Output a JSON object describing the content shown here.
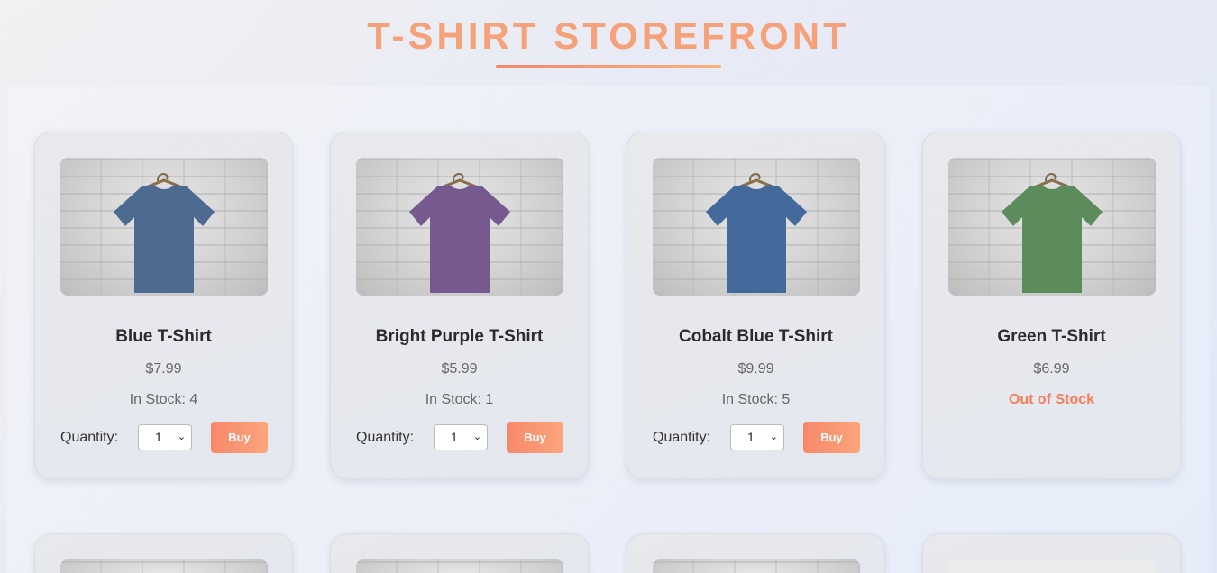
{
  "header": {
    "title": "T-SHIRT STOREFRONT"
  },
  "colors": {
    "accent": "#f5a27a",
    "accent_dark": "#f4866a",
    "out_of_stock": "#f57d5a"
  },
  "labels": {
    "quantity": "Quantity:",
    "buy": "Buy"
  },
  "products": [
    {
      "name": "Blue T-Shirt",
      "price": "$7.99",
      "stock": "In Stock: 4",
      "quantity": "1",
      "shirt_color": "#4d6b91"
    },
    {
      "name": "Bright Purple T-Shirt",
      "price": "$5.99",
      "stock": "In Stock: 1",
      "quantity": "1",
      "shirt_color": "#765a8f"
    },
    {
      "name": "Cobalt Blue T-Shirt",
      "price": "$9.99",
      "stock": "In Stock: 5",
      "quantity": "1",
      "shirt_color": "#436a9b"
    },
    {
      "name": "Green T-Shirt",
      "price": "$6.99",
      "stock": "Out of Stock",
      "shirt_color": "#5d8c5c"
    }
  ]
}
